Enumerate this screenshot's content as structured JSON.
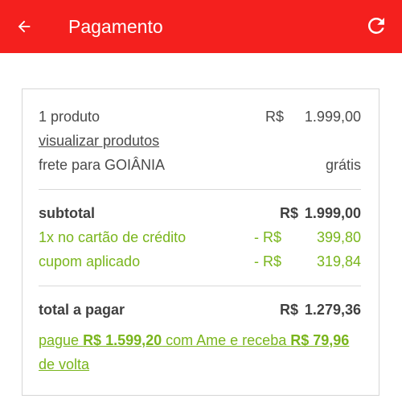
{
  "header": {
    "title": "Pagamento",
    "back_icon": "arrow-left-icon",
    "refresh_icon": "refresh-icon",
    "background_color": "#f4201e"
  },
  "summary": {
    "products_label": "1 produto",
    "products_currency": "R$",
    "products_amount": "1.999,00",
    "view_products_link": "visualizar produtos",
    "shipping_label": "frete para GOIÂNIA",
    "shipping_value": "grátis",
    "subtotal_label": "subtotal",
    "subtotal_currency": "R$",
    "subtotal_amount": "1.999,00",
    "credit_label": "1x no cartão de crédito",
    "credit_currency": "- R$",
    "credit_amount": "399,80",
    "coupon_label": "cupom aplicado",
    "coupon_currency": "- R$",
    "coupon_amount": "319,84",
    "total_label": "total a pagar",
    "total_currency": "R$",
    "total_amount": "1.279,36",
    "ame_prefix": "pague ",
    "ame_pay_amount": "R$ 1.599,20",
    "ame_middle": " com Ame e receba ",
    "ame_cashback_amount": "R$ 79,96",
    "ame_suffix": " de volta",
    "accent_green": "#79b51c"
  }
}
